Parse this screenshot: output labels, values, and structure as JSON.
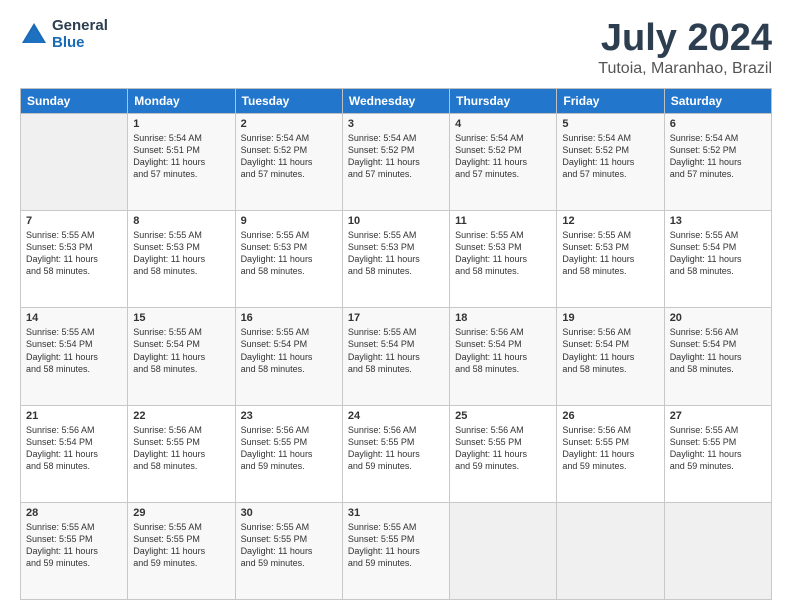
{
  "header": {
    "logo": {
      "general": "General",
      "blue": "Blue"
    },
    "title": "July 2024",
    "subtitle": "Tutoia, Maranhao, Brazil"
  },
  "calendar": {
    "days_of_week": [
      "Sunday",
      "Monday",
      "Tuesday",
      "Wednesday",
      "Thursday",
      "Friday",
      "Saturday"
    ],
    "weeks": [
      [
        {
          "day": "",
          "info": ""
        },
        {
          "day": "1",
          "info": "Sunrise: 5:54 AM\nSunset: 5:51 PM\nDaylight: 11 hours\nand 57 minutes."
        },
        {
          "day": "2",
          "info": "Sunrise: 5:54 AM\nSunset: 5:52 PM\nDaylight: 11 hours\nand 57 minutes."
        },
        {
          "day": "3",
          "info": "Sunrise: 5:54 AM\nSunset: 5:52 PM\nDaylight: 11 hours\nand 57 minutes."
        },
        {
          "day": "4",
          "info": "Sunrise: 5:54 AM\nSunset: 5:52 PM\nDaylight: 11 hours\nand 57 minutes."
        },
        {
          "day": "5",
          "info": "Sunrise: 5:54 AM\nSunset: 5:52 PM\nDaylight: 11 hours\nand 57 minutes."
        },
        {
          "day": "6",
          "info": "Sunrise: 5:54 AM\nSunset: 5:52 PM\nDaylight: 11 hours\nand 57 minutes."
        }
      ],
      [
        {
          "day": "7",
          "info": "Sunrise: 5:55 AM\nSunset: 5:53 PM\nDaylight: 11 hours\nand 58 minutes."
        },
        {
          "day": "8",
          "info": "Sunrise: 5:55 AM\nSunset: 5:53 PM\nDaylight: 11 hours\nand 58 minutes."
        },
        {
          "day": "9",
          "info": "Sunrise: 5:55 AM\nSunset: 5:53 PM\nDaylight: 11 hours\nand 58 minutes."
        },
        {
          "day": "10",
          "info": "Sunrise: 5:55 AM\nSunset: 5:53 PM\nDaylight: 11 hours\nand 58 minutes."
        },
        {
          "day": "11",
          "info": "Sunrise: 5:55 AM\nSunset: 5:53 PM\nDaylight: 11 hours\nand 58 minutes."
        },
        {
          "day": "12",
          "info": "Sunrise: 5:55 AM\nSunset: 5:53 PM\nDaylight: 11 hours\nand 58 minutes."
        },
        {
          "day": "13",
          "info": "Sunrise: 5:55 AM\nSunset: 5:54 PM\nDaylight: 11 hours\nand 58 minutes."
        }
      ],
      [
        {
          "day": "14",
          "info": "Sunrise: 5:55 AM\nSunset: 5:54 PM\nDaylight: 11 hours\nand 58 minutes."
        },
        {
          "day": "15",
          "info": "Sunrise: 5:55 AM\nSunset: 5:54 PM\nDaylight: 11 hours\nand 58 minutes."
        },
        {
          "day": "16",
          "info": "Sunrise: 5:55 AM\nSunset: 5:54 PM\nDaylight: 11 hours\nand 58 minutes."
        },
        {
          "day": "17",
          "info": "Sunrise: 5:55 AM\nSunset: 5:54 PM\nDaylight: 11 hours\nand 58 minutes."
        },
        {
          "day": "18",
          "info": "Sunrise: 5:56 AM\nSunset: 5:54 PM\nDaylight: 11 hours\nand 58 minutes."
        },
        {
          "day": "19",
          "info": "Sunrise: 5:56 AM\nSunset: 5:54 PM\nDaylight: 11 hours\nand 58 minutes."
        },
        {
          "day": "20",
          "info": "Sunrise: 5:56 AM\nSunset: 5:54 PM\nDaylight: 11 hours\nand 58 minutes."
        }
      ],
      [
        {
          "day": "21",
          "info": "Sunrise: 5:56 AM\nSunset: 5:54 PM\nDaylight: 11 hours\nand 58 minutes."
        },
        {
          "day": "22",
          "info": "Sunrise: 5:56 AM\nSunset: 5:55 PM\nDaylight: 11 hours\nand 58 minutes."
        },
        {
          "day": "23",
          "info": "Sunrise: 5:56 AM\nSunset: 5:55 PM\nDaylight: 11 hours\nand 59 minutes."
        },
        {
          "day": "24",
          "info": "Sunrise: 5:56 AM\nSunset: 5:55 PM\nDaylight: 11 hours\nand 59 minutes."
        },
        {
          "day": "25",
          "info": "Sunrise: 5:56 AM\nSunset: 5:55 PM\nDaylight: 11 hours\nand 59 minutes."
        },
        {
          "day": "26",
          "info": "Sunrise: 5:56 AM\nSunset: 5:55 PM\nDaylight: 11 hours\nand 59 minutes."
        },
        {
          "day": "27",
          "info": "Sunrise: 5:55 AM\nSunset: 5:55 PM\nDaylight: 11 hours\nand 59 minutes."
        }
      ],
      [
        {
          "day": "28",
          "info": "Sunrise: 5:55 AM\nSunset: 5:55 PM\nDaylight: 11 hours\nand 59 minutes."
        },
        {
          "day": "29",
          "info": "Sunrise: 5:55 AM\nSunset: 5:55 PM\nDaylight: 11 hours\nand 59 minutes."
        },
        {
          "day": "30",
          "info": "Sunrise: 5:55 AM\nSunset: 5:55 PM\nDaylight: 11 hours\nand 59 minutes."
        },
        {
          "day": "31",
          "info": "Sunrise: 5:55 AM\nSunset: 5:55 PM\nDaylight: 11 hours\nand 59 minutes."
        },
        {
          "day": "",
          "info": ""
        },
        {
          "day": "",
          "info": ""
        },
        {
          "day": "",
          "info": ""
        }
      ]
    ]
  }
}
